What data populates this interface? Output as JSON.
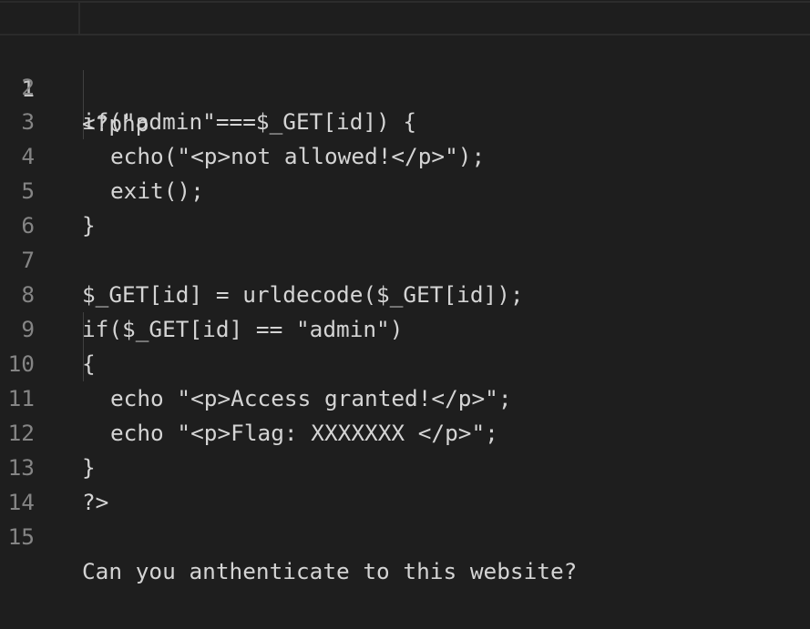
{
  "editor": {
    "current_line": 1,
    "lines": [
      {
        "number": "1",
        "text": "<?php",
        "indent": 0
      },
      {
        "number": "2",
        "text": "if(\"admin\"===$_GET[id]) {",
        "indent": 0
      },
      {
        "number": "3",
        "text": "echo(\"<p>not allowed!</p>\");",
        "indent": 1
      },
      {
        "number": "4",
        "text": "exit();",
        "indent": 1
      },
      {
        "number": "5",
        "text": "}",
        "indent": 0
      },
      {
        "number": "6",
        "text": "",
        "indent": 0
      },
      {
        "number": "7",
        "text": "$_GET[id] = urldecode($_GET[id]);",
        "indent": 0
      },
      {
        "number": "8",
        "text": "if($_GET[id] == \"admin\")",
        "indent": 0
      },
      {
        "number": "9",
        "text": "{",
        "indent": 0
      },
      {
        "number": "10",
        "text": "echo \"<p>Access granted!</p>\";",
        "indent": 1
      },
      {
        "number": "11",
        "text": "echo \"<p>Flag: XXXXXXX </p>\";",
        "indent": 1
      },
      {
        "number": "12",
        "text": "}",
        "indent": 0
      },
      {
        "number": "13",
        "text": "?>",
        "indent": 0
      },
      {
        "number": "14",
        "text": "",
        "indent": 0
      },
      {
        "number": "15",
        "text": "Can you anthenticate to this website?",
        "indent": 0
      }
    ]
  },
  "colors": {
    "background": "#1e1e1e",
    "text": "#d4d4d4",
    "line_number": "#858585",
    "line_number_active": "#c6c6c6",
    "indent_guide": "#404040"
  }
}
